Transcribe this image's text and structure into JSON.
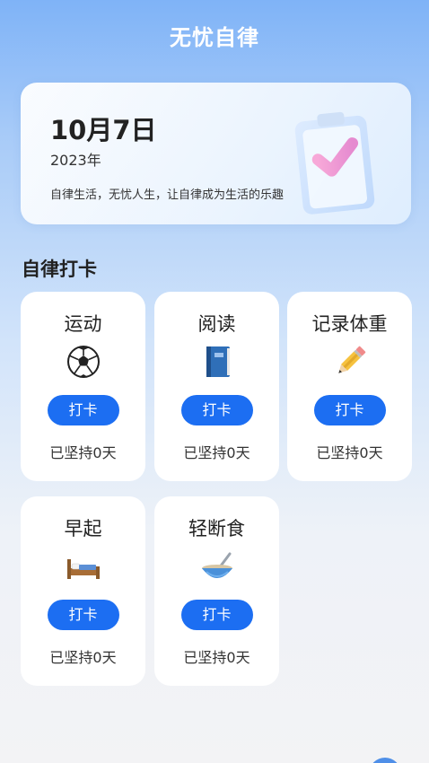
{
  "header": {
    "title": "无忧自律"
  },
  "hero": {
    "date": "10月7日",
    "year": "2023年",
    "slogan": "自律生活，无忧人生，让自律成为生活的乐趣",
    "illustration_icon": "clipboard-check-icon"
  },
  "section": {
    "title": "自律打卡"
  },
  "habits": [
    {
      "name": "运动",
      "icon": "soccer-ball-icon",
      "button_label": "打卡",
      "streak": "已坚持0天"
    },
    {
      "name": "阅读",
      "icon": "blue-book-icon",
      "button_label": "打卡",
      "streak": "已坚持0天"
    },
    {
      "name": "记录体重",
      "icon": "pencil-icon",
      "button_label": "打卡",
      "streak": "已坚持0天"
    },
    {
      "name": "早起",
      "icon": "bed-icon",
      "button_label": "打卡",
      "streak": "已坚持0天"
    },
    {
      "name": "轻断食",
      "icon": "bowl-icon",
      "button_label": "打卡",
      "streak": "已坚持0天"
    }
  ],
  "colors": {
    "accent": "#1c6ef2",
    "header_gradient_top": "#7fb3f7",
    "background_bottom": "#f3f3f5"
  }
}
